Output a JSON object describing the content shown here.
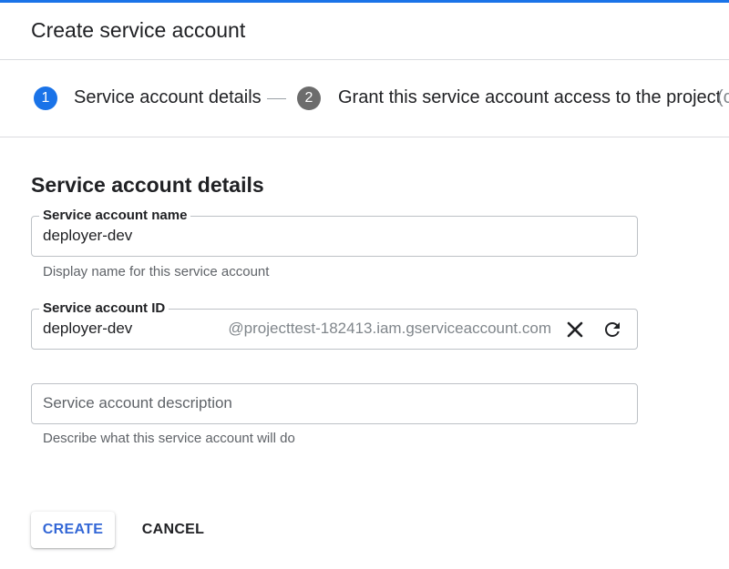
{
  "page": {
    "title": "Create service account"
  },
  "colors": {
    "accent": "#1a73e8",
    "step_inactive": "#6c6c6c",
    "primary_button_text": "#3367d6"
  },
  "stepper": {
    "steps": [
      {
        "number": "1",
        "label": "Service account details",
        "state": "active"
      },
      {
        "number": "2",
        "label": "Grant this service account access to the project",
        "state": "inactive"
      }
    ],
    "overflow_text": "(c"
  },
  "form": {
    "section_title": "Service account details",
    "name": {
      "label": "Service account name",
      "value": "deployer-dev",
      "hint": "Display name for this service account"
    },
    "id": {
      "label": "Service account ID",
      "value": "deployer-dev",
      "suffix": "@projecttest-182413.iam.gserviceaccount.com",
      "clear_icon": "close-icon",
      "refresh_icon": "refresh-icon"
    },
    "description": {
      "placeholder": "Service account description",
      "value": "",
      "hint": "Describe what this service account will do"
    }
  },
  "actions": {
    "create_label": "CREATE",
    "cancel_label": "CANCEL"
  }
}
